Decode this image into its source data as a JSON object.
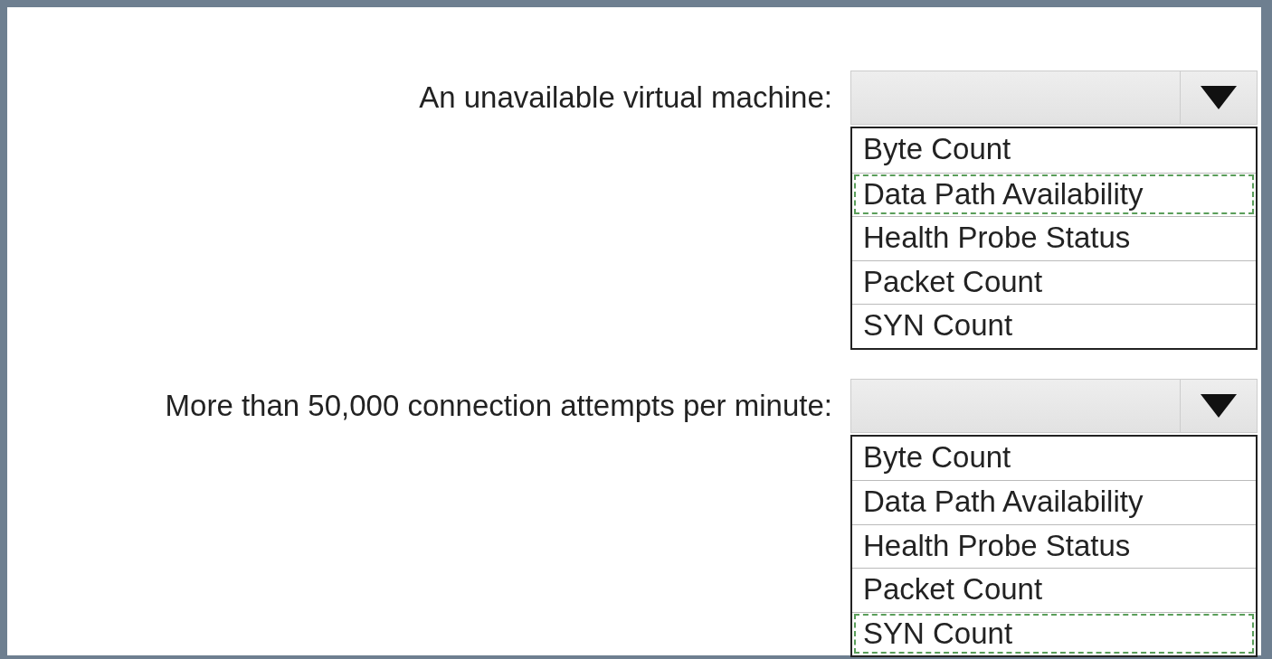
{
  "questions": [
    {
      "label": "An unavailable virtual machine:",
      "options": [
        {
          "text": "Byte Count",
          "selected": false
        },
        {
          "text": "Data Path Availability",
          "selected": true
        },
        {
          "text": "Health Probe Status",
          "selected": false
        },
        {
          "text": "Packet Count",
          "selected": false
        },
        {
          "text": "SYN Count",
          "selected": false
        }
      ]
    },
    {
      "label": "More than 50,000 connection attempts per minute:",
      "options": [
        {
          "text": "Byte Count",
          "selected": false
        },
        {
          "text": "Data Path Availability",
          "selected": false
        },
        {
          "text": "Health Probe Status",
          "selected": false
        },
        {
          "text": "Packet Count",
          "selected": false
        },
        {
          "text": "SYN Count",
          "selected": true
        }
      ]
    }
  ]
}
